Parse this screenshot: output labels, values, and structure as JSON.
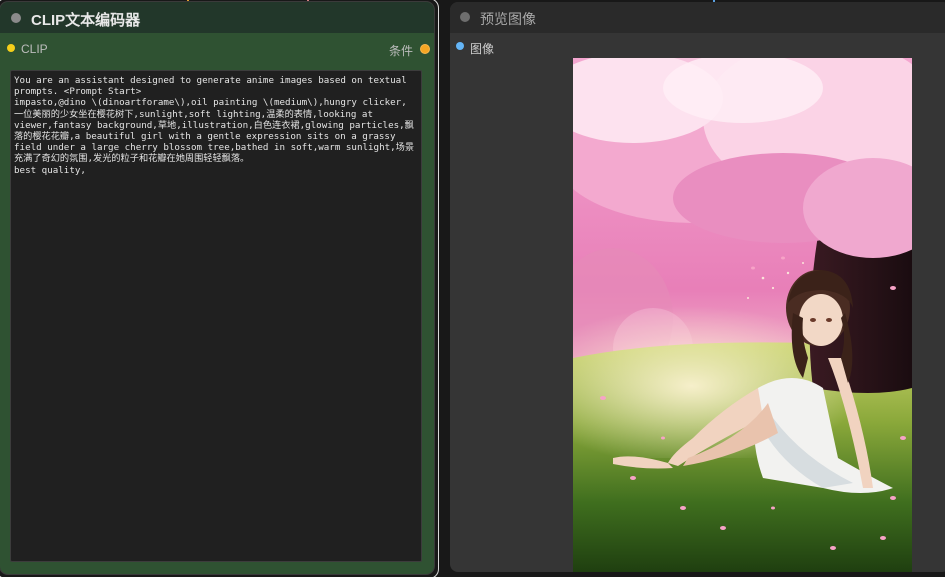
{
  "clip_node": {
    "title": "CLIP文本编码器",
    "input_label": "CLIP",
    "output_label": "条件",
    "prompt_text": "You are an assistant designed to generate anime images based on textual prompts. <Prompt Start>\nimpasto,@dino \\(dinoartforame\\),oil painting \\(medium\\),hungry clicker,\n一位美丽的少女坐在樱花树下,sunlight,soft lighting,温柔的表情,looking at viewer,fantasy background,草地,illustration,白色连衣裙,glowing particles,飘落的樱花花瓣,a beautiful girl with a gentle expression sits on a grassy field under a large cherry blossom tree,bathed in soft,warm sunlight,场景充满了奇幻的氛围,发光的粒子和花瓣在她周围轻轻飘落。\nbest quality,"
  },
  "preview_node": {
    "title": "预览图像",
    "input_label": "图像"
  },
  "colors": {
    "clip_node_body": "#2f5232",
    "clip_node_title": "#22372a",
    "clip_slot": "#f5cf1a",
    "conditioning_slot": "#f5a623",
    "image_slot": "#64b5f6",
    "preview_node_body": "#353535"
  }
}
